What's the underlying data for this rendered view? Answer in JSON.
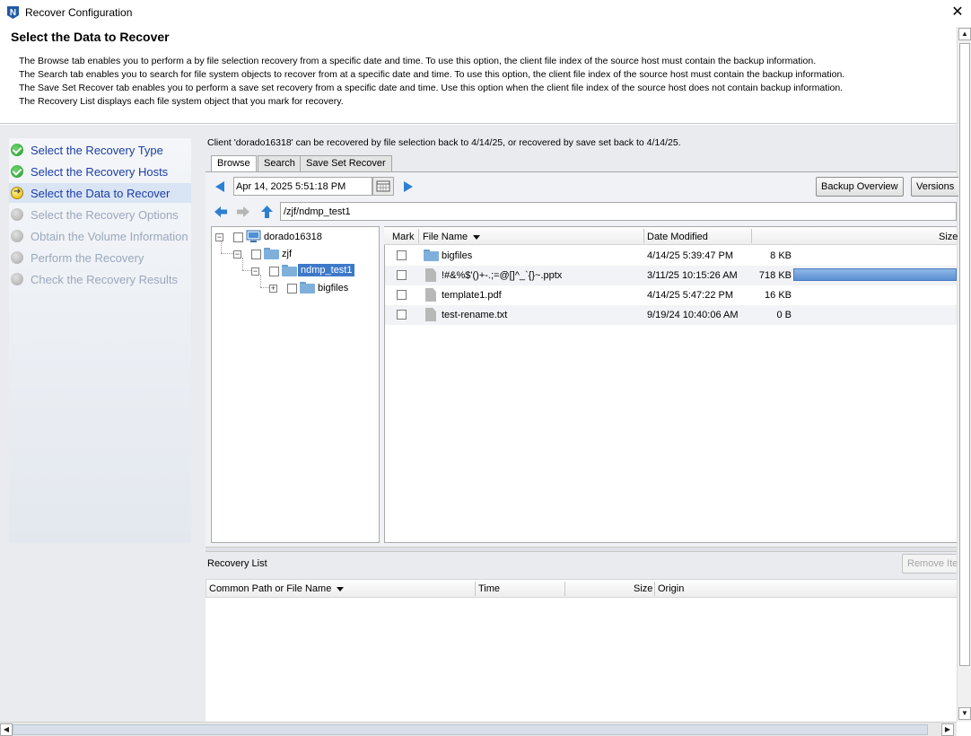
{
  "window": {
    "title": "Recover Configuration",
    "close_symbol": "✕",
    "app_icon_letter": "N"
  },
  "header": {
    "title": "Select the Data to Recover",
    "lines": [
      "The Browse tab enables you to perform a by file selection recovery from a specific date and time. To use this option, the client file index of the source host must contain the backup information.",
      "The Search tab enables you to search for file system objects to recover from at a specific date and time. To use this option, the client file index of the source host must contain the backup information.",
      "The Save Set Recover tab enables you to perform a save set recovery from a specific date and time.  Use this option when the client file index of the source host does not contain backup information.",
      "The Recovery List displays each file system object that you mark for recovery."
    ]
  },
  "wizard": {
    "steps": [
      {
        "label": "Select the Recovery Type",
        "status": "done"
      },
      {
        "label": "Select the Recovery Hosts",
        "status": "done"
      },
      {
        "label": "Select the Data to Recover",
        "status": "current"
      },
      {
        "label": "Select the Recovery Options",
        "status": "pending"
      },
      {
        "label": "Obtain the Volume Information",
        "status": "pending"
      },
      {
        "label": "Perform the Recovery",
        "status": "pending"
      },
      {
        "label": "Check the Recovery Results",
        "status": "pending"
      }
    ]
  },
  "client_info": "Client 'dorado16318' can be recovered by file selection back to 4/14/25, or recovered by save set back to 4/14/25.",
  "tabs": [
    {
      "label": "Browse",
      "active": true
    },
    {
      "label": "Search",
      "active": false
    },
    {
      "label": "Save Set Recover",
      "active": false
    }
  ],
  "browse": {
    "date_value": "Apr 14, 2025 5:51:18 PM",
    "backup_overview_label": "Backup Overview",
    "versions_label": "Versions",
    "path_value": "/zjf/ndmp_test1"
  },
  "tree": {
    "nodes": [
      {
        "label": "dorado16318",
        "expander": "−"
      },
      {
        "label": "zjf",
        "expander": "−"
      },
      {
        "label": "ndmp_test1",
        "expander": "−",
        "selected": true
      },
      {
        "label": "bigfiles",
        "expander": "+"
      }
    ]
  },
  "file_table": {
    "columns": {
      "mark": "Mark",
      "name": "File Name",
      "date": "Date Modified",
      "size": "Size"
    },
    "rows": [
      {
        "name": "bigfiles",
        "type": "folder",
        "date": "4/14/25 5:39:47 PM",
        "size": "8 KB",
        "size_fraction": 0.0
      },
      {
        "name": "!#&%$'()+-.;=@[]^_`{}~.pptx",
        "type": "file",
        "date": "3/11/25 10:15:26 AM",
        "size": "718 KB",
        "size_fraction": 1.0
      },
      {
        "name": "template1.pdf",
        "type": "file",
        "date": "4/14/25 5:47:22 PM",
        "size": "16 KB",
        "size_fraction": 0.0
      },
      {
        "name": "test-rename.txt",
        "type": "file",
        "date": "9/19/24 10:40:06 AM",
        "size": "0 B",
        "size_fraction": 0.0
      }
    ]
  },
  "recovery_list": {
    "title": "Recovery List",
    "remove_label": "Remove Item",
    "columns": {
      "path": "Common Path or File Name",
      "time": "Time",
      "size": "Size",
      "origin": "Origin"
    }
  },
  "colors": {
    "accent": "#3d79c9",
    "step_active_text": "#1b3ea8",
    "step_pending_text": "#9aa8bd",
    "size_bar": "#5a8fd0"
  }
}
